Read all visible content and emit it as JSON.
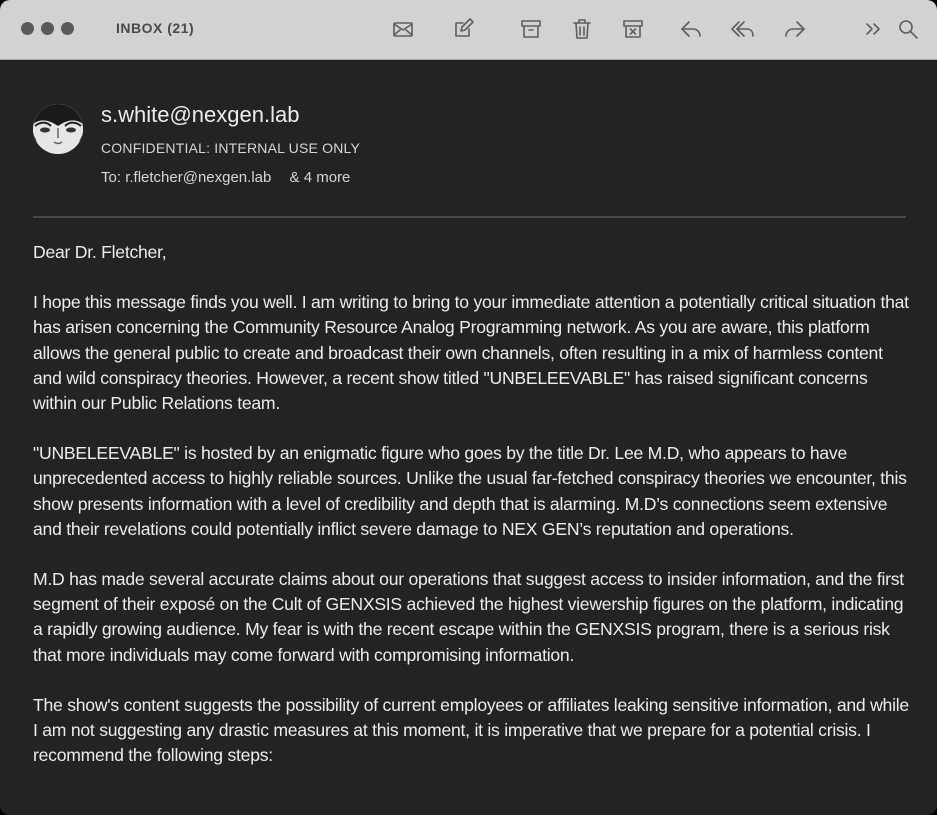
{
  "window": {
    "title": "INBOX (21)"
  },
  "toolbar": {
    "icons": [
      "envelope-icon",
      "compose-icon",
      "archive-icon",
      "trash-icon",
      "junk-icon",
      "reply-icon",
      "reply-all-icon",
      "forward-icon",
      "more-chevron-icon",
      "search-icon"
    ]
  },
  "email": {
    "sender": "s.white@nexgen.lab",
    "subject": "CONFIDENTIAL: INTERNAL USE ONLY",
    "to_label": "To:",
    "to_address": "r.fletcher@nexgen.lab",
    "more_recipients": "& 4 more",
    "paragraphs": [
      "Dear Dr. Fletcher,",
      "I hope this message finds you well. I am writing to bring to your immediate attention a potentially critical situation that has arisen concerning the Community Resource Analog Programming network. As you are aware, this platform allows the general public to create and broadcast their own channels, often resulting in a mix of harmless content and wild conspiracy theories. However, a recent show titled \"UNBELEEVABLE\" has raised significant concerns within our Public Relations team.",
      "\"UNBELEEVABLE\" is hosted by an enigmatic figure who goes by the title Dr. Lee M.D, who appears to have unprecedented access to highly reliable sources. Unlike the usual far-fetched conspiracy theories we encounter, this show presents information with a level of credibility and depth that is alarming. M.D’s connections seem extensive and their revelations could potentially inflict severe damage to NEX GEN’s reputation and operations.",
      "M.D has made several accurate claims about our operations that suggest access to insider information, and the first segment of their exposé on the Cult of GENXSIS achieved the highest viewership figures on the platform, indicating a rapidly growing audience. My fear is with the recent escape within the GENXSIS program, there is a serious risk that more individuals may come forward with compromising information.",
      "The show's content suggests the possibility of current employees or affiliates leaking sensitive information, and while I am not suggesting any drastic measures at this moment, it is imperative that we prepare for a potential crisis. I recommend the following steps:"
    ]
  }
}
